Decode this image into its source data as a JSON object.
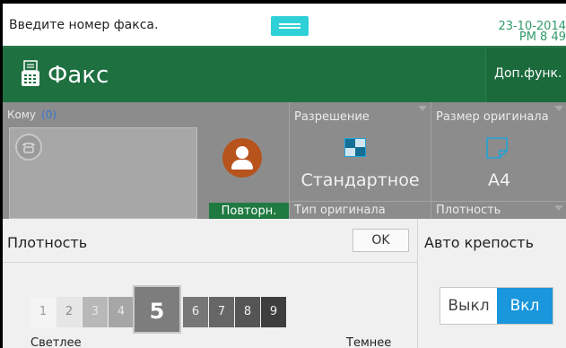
{
  "status": {
    "message": "Введите номер факса.",
    "date": "23-10-2014",
    "time": "PM 8 49"
  },
  "titlebar": {
    "title": "Факс",
    "more_label": "Доп.функ."
  },
  "destination": {
    "to_label": "Кому",
    "count": "(0)",
    "redial_label": "Повторн."
  },
  "settings": {
    "resolution": {
      "label": "Разрешение",
      "value": "Стандартное"
    },
    "original_size": {
      "label": "Размер оригинала",
      "value": "A4"
    },
    "original_type": {
      "label": "Тип оригинала"
    },
    "density": {
      "label": "Плотность"
    }
  },
  "density_popup": {
    "title": "Плотность",
    "ok_label": "OK",
    "auto_label": "Авто крепость",
    "levels": [
      "1",
      "2",
      "3",
      "4",
      "5",
      "6",
      "7",
      "8",
      "9"
    ],
    "selected_level": 5,
    "light_label": "Светлее",
    "dark_label": "Темнее",
    "toggle_off": "Выкл",
    "toggle_on": "Вкл",
    "toggle_state": "on"
  },
  "colors": {
    "title_bar": "#1e7040",
    "accent_blue": "#1a96dc",
    "time_green": "#2f9b6a",
    "handle_cyan": "#2fd0d8"
  }
}
